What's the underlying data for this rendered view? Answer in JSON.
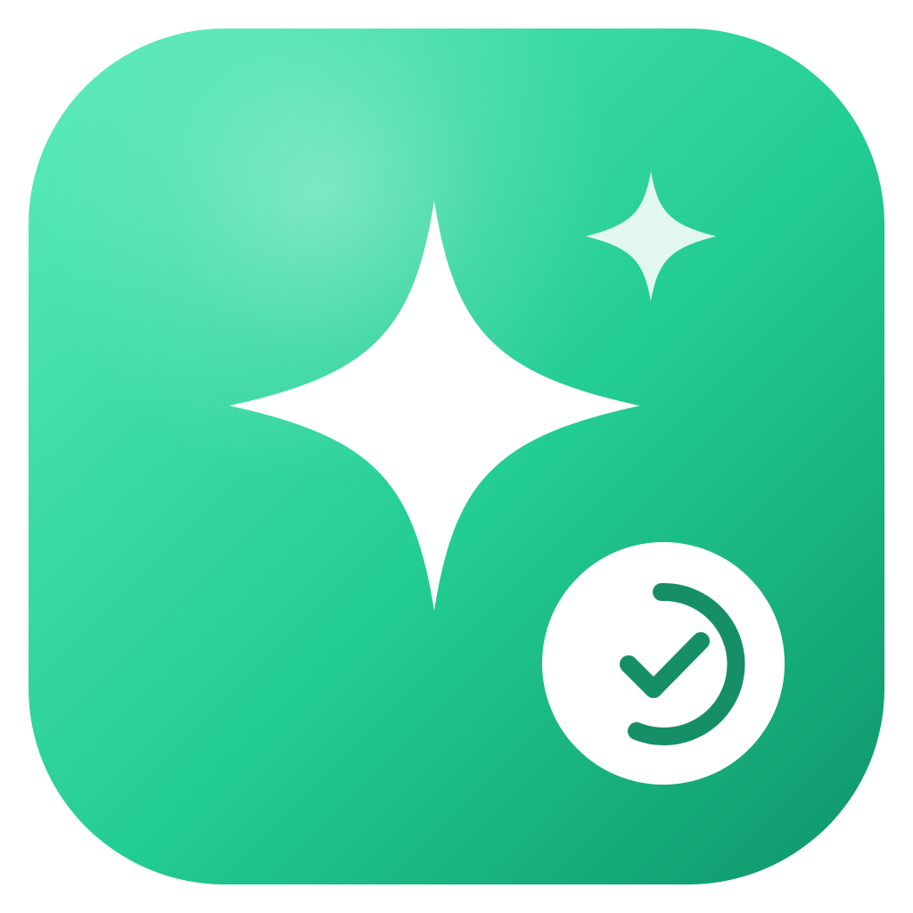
{
  "app_icon": {
    "icons": {
      "background": "rounded-square-icon",
      "large_sparkle": "sparkle-icon",
      "small_sparkle": "sparkle-icon",
      "status_badge": "check-circle-progress-icon"
    },
    "colors": {
      "gradient_top_left": "#5CEBBD",
      "gradient_mid": "#22CC92",
      "gradient_bottom_right": "#0E946B",
      "highlight": "#FFFFFF",
      "large_sparkle": "#FFFFFF",
      "small_sparkle": "#E2F8EF",
      "badge_fill": "#FFFFFF",
      "badge_stroke": "#168F69"
    }
  }
}
